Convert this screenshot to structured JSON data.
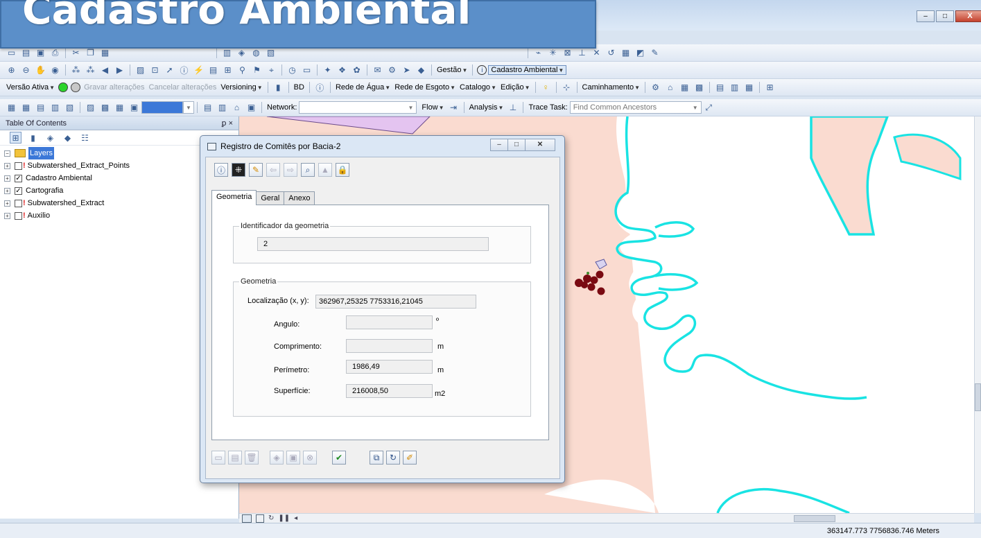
{
  "banner": {
    "title": "Cadastro Ambiental"
  },
  "window": {
    "min": "–",
    "max": "□",
    "close": "X"
  },
  "toolbar3": {
    "versao": "Versão Ativa",
    "gravar": "Gravar alterações",
    "cancelar": "Cancelar alterações",
    "versioning": "Versioning",
    "bd": "BD",
    "agua": "Rede de Água",
    "esgoto": "Rede de Esgoto",
    "catalogo": "Catalogo",
    "edicao": "Edição",
    "caminhamento": "Caminhamento"
  },
  "toolbar2": {
    "gestao": "Gestão",
    "cadastro": "Cadastro Ambiental"
  },
  "toolbar4": {
    "network": "Network:",
    "flow": "Flow",
    "analysis": "Analysis",
    "trace_task": "Trace Task:",
    "trace_value": "Find Common Ancestors"
  },
  "toc": {
    "title": "Table Of Contents",
    "pin": "ꝑ ×",
    "root": "Layers",
    "layers": [
      {
        "name": "Subwatershed_Extract_Points",
        "checked": false
      },
      {
        "name": "Cadastro Ambiental",
        "checked": true
      },
      {
        "name": "Cartografia",
        "checked": true
      },
      {
        "name": "Subwatershed_Extract",
        "checked": false
      },
      {
        "name": "Auxilio",
        "checked": false
      }
    ]
  },
  "dialog": {
    "title": "Registro de Comitês por Bacia-2",
    "tabs": [
      "Geometria",
      "Geral",
      "Anexo"
    ],
    "ident_group": "Identificador da geometria",
    "ident_value": "2",
    "geom_group": "Geometria",
    "loc_label": "Localização (x, y):",
    "loc_value": "362967,25325    7753316,21045",
    "angulo_label": "Angulo:",
    "angulo_value": "",
    "angulo_unit": "º",
    "comp_label": "Comprimento:",
    "comp_value": "",
    "comp_unit": "m",
    "perim_label": "Perímetro:",
    "perim_value": "1986,49",
    "perim_unit": "m",
    "sup_label": "Superfície:",
    "sup_value": "216008,50",
    "sup_unit": "m2"
  },
  "status": {
    "coords": "363147.773  7756836.746 Meters"
  },
  "colors": {
    "land": "#fadbd0",
    "coast": "#19e3e3",
    "points": "#7a0a12",
    "banner": "#5b8fc9"
  }
}
